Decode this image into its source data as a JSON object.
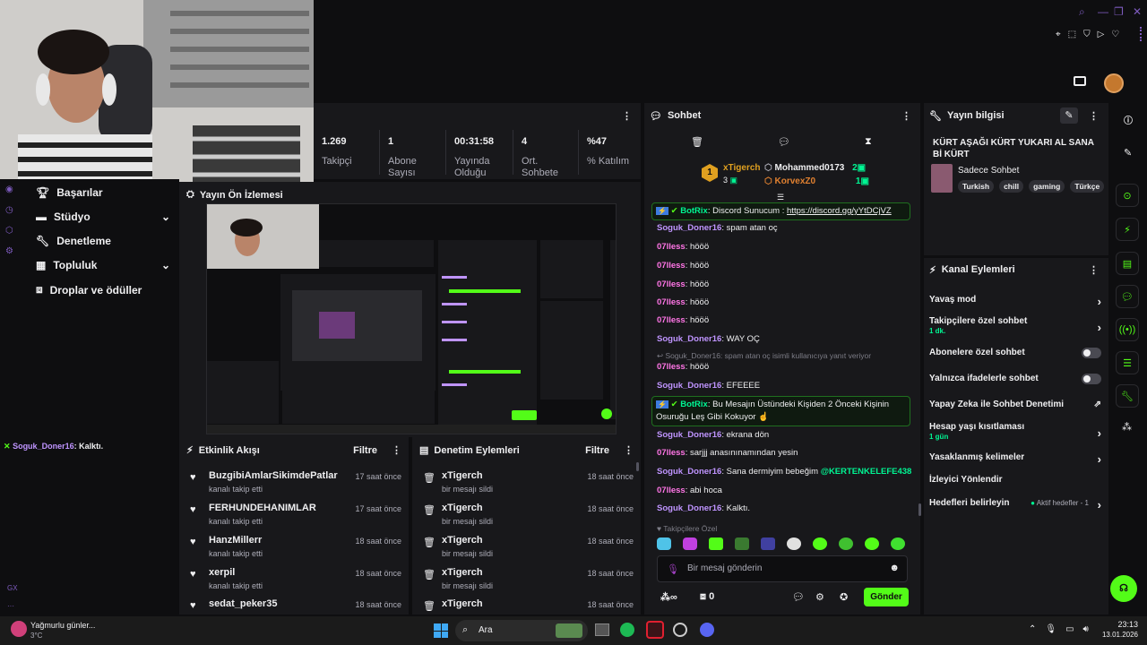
{
  "stats": [
    {
      "value": "1.269",
      "label": "Takipçi"
    },
    {
      "value": "1",
      "label": "Abone Sayısı"
    },
    {
      "value": "00:31:58",
      "label": "Yayında Olduğu"
    },
    {
      "value": "4",
      "label": "Ort. Sohbete"
    },
    {
      "value": "%47",
      "label": "% Katılım"
    }
  ],
  "nav": {
    "achievements": "Başarılar",
    "studio": "Stüdyo",
    "moderation": "Denetleme",
    "community": "Topluluk",
    "drops": "Droplar ve ödüller"
  },
  "overlay_chat": {
    "user": "Soguk_Doner16",
    "text": ": Kalktı."
  },
  "preview": {
    "title": "Yayın Ön İzlemesi"
  },
  "activity": {
    "title": "Etkinlik Akışı",
    "filter": "Filtre",
    "items": [
      {
        "name": "BuzgibiAmlarSikimdePatlar",
        "sub": "kanalı takip etti",
        "time": "17 saat önce"
      },
      {
        "name": "FERHUNDEHANIMLAR",
        "sub": "kanalı takip etti",
        "time": "17 saat önce"
      },
      {
        "name": "HanzMillerr",
        "sub": "kanalı takip etti",
        "time": "18 saat önce"
      },
      {
        "name": "xerpil",
        "sub": "kanalı takip etti",
        "time": "18 saat önce"
      },
      {
        "name": "sedat_peker35",
        "sub": "",
        "time": "18 saat önce"
      }
    ]
  },
  "modlog": {
    "title": "Denetim Eylemleri",
    "filter": "Filtre",
    "items": [
      {
        "name": "xTigerch",
        "sub": "bir mesajı sildi",
        "time": "18 saat önce"
      },
      {
        "name": "xTigerch",
        "sub": "bir mesajı sildi",
        "time": "18 saat önce"
      },
      {
        "name": "xTigerch",
        "sub": "bir mesajı sildi",
        "time": "18 saat önce"
      },
      {
        "name": "xTigerch",
        "sub": "bir mesajı sildi",
        "time": "18 saat önce"
      },
      {
        "name": "xTigerch",
        "sub": "",
        "time": "18 saat önce"
      }
    ]
  },
  "chat": {
    "title": "Sohbet",
    "leaders": [
      {
        "rank": "1",
        "name": "xTigerch",
        "count": "3"
      },
      {
        "rank": "",
        "name": "Mohammed0173",
        "count": "2"
      },
      {
        "rank": "",
        "name": "KorvexZ0",
        "count": "1"
      }
    ],
    "bot1": {
      "user": "BotRix",
      "text": ": Discord Sunucum : ",
      "link": "https://discord.gg/yYtDCjVZ"
    },
    "messages": [
      {
        "user": "Soguk_Doner16",
        "text": ": spam atan oç",
        "color": "#bf94ff"
      },
      {
        "user": "07lless",
        "text": ": hööö",
        "color": "#ff75e6"
      },
      {
        "user": "07lless",
        "text": ": hööö",
        "color": "#ff75e6"
      },
      {
        "user": "07lless",
        "text": ": hööö",
        "color": "#ff75e6"
      },
      {
        "user": "07lless",
        "text": ": hööö",
        "color": "#ff75e6"
      },
      {
        "user": "07lless",
        "text": ": hööö",
        "color": "#ff75e6"
      },
      {
        "user": "Soguk_Doner16",
        "text": ": WAY OÇ",
        "color": "#bf94ff"
      }
    ],
    "reply_note": "Soguk_Doner16: spam atan oç isimli kullanıcıya yanıt veriyor",
    "messages2": [
      {
        "user": "07lless",
        "text": ": hööö",
        "color": "#ff75e6"
      },
      {
        "user": "Soguk_Doner16",
        "text": ": EFEEEE",
        "color": "#bf94ff"
      }
    ],
    "bot2": {
      "user": "BotRix",
      "text": ": Bu Mesajın Üstündeki Kişiden 2 Önceki Kişinin Osuruğu Leş Gibi Kokuyor ☝"
    },
    "messages3": [
      {
        "user": "Soguk_Doner16",
        "text": ": ekrana dön",
        "color": "#bf94ff"
      },
      {
        "user": "07lless",
        "text": ": sarjjj anasınınamından yesin",
        "color": "#ff75e6"
      },
      {
        "user": "Soguk_Doner16",
        "text": ": Sana dermiyim bebeğim ",
        "mention": "@KERTENKELEFE438",
        "color": "#bf94ff"
      },
      {
        "user": "07lless",
        "text": ": abi hoca",
        "color": "#ff75e6"
      },
      {
        "user": "Soguk_Doner16",
        "text": ": Kalktı.",
        "color": "#bf94ff"
      }
    ],
    "emote_label": "Takipçilere Özel",
    "input_placeholder": "Bir mesaj gönderin",
    "points": "0",
    "send": "Gönder"
  },
  "info": {
    "title": "Yayın bilgisi",
    "stream_title": "KÜRT AŞAĞI KÜRT YUKARI AL SANA Bİ KÜRT",
    "category": "Sadece Sohbet",
    "tags": [
      "Turkish",
      "chill",
      "gaming",
      "Türkçe"
    ]
  },
  "actions": {
    "title": "Kanal Eylemleri",
    "items": [
      {
        "label": "Yavaş mod",
        "sub": "",
        "control": "chevron"
      },
      {
        "label": "Takipçilere özel sohbet",
        "sub": "1 dk.",
        "control": "chevron"
      },
      {
        "label": "Abonelere özel sohbet",
        "sub": "",
        "control": "toggle"
      },
      {
        "label": "Yalnızca ifadelerle sohbet",
        "sub": "",
        "control": "toggle"
      },
      {
        "label": "Yapay Zeka ile Sohbet Denetimi",
        "sub": "",
        "control": "external"
      },
      {
        "label": "Hesap yaşı kısıtlaması",
        "sub": "1 gün",
        "control": "chevron"
      },
      {
        "label": "Yasaklanmış kelimeler",
        "sub": "",
        "control": "chevron"
      },
      {
        "label": "İzleyici Yönlendir",
        "sub": "",
        "control": "none"
      },
      {
        "label": "Hedefleri belirleyin",
        "sub": "",
        "control": "chevron",
        "status": "Aktif hedefler - 1"
      }
    ]
  },
  "taskbar": {
    "weather": "Yağmurlu günler...",
    "temp": "3°C",
    "search": "Ara",
    "time": "23:13",
    "date": "13.01.2026"
  },
  "colors": {
    "accent": "#53fc18",
    "bg": "#0e0e10",
    "panel": "#18181b",
    "purple": "#7d5bbe"
  }
}
